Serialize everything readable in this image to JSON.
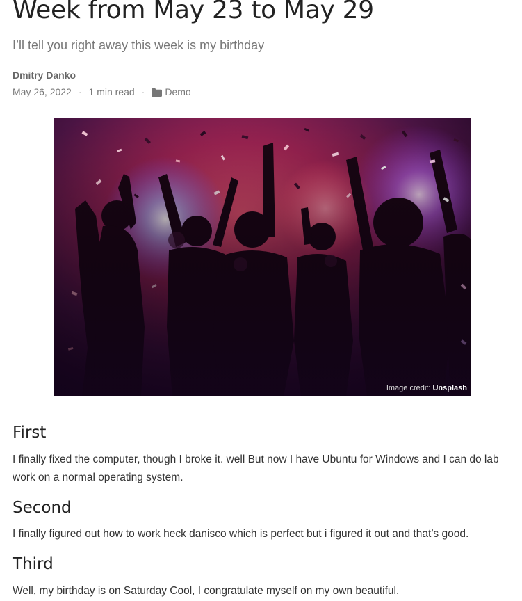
{
  "post": {
    "title": "Week from May 23 to May 29",
    "subtitle": "I’ll tell you right away this week is my birthday",
    "author": "Dmitry Danko",
    "date": "May 26, 2022",
    "read_time": "1 min read",
    "category": "Demo",
    "category_icon": "folder-icon",
    "image": {
      "credit_label": "Image credit:",
      "credit_source": "Unsplash"
    },
    "sections": [
      {
        "heading": "First",
        "body": "I finally fixed the computer, though I broke it. well But now I have Ubuntu for Windows and I can do lab work on a normal operating system."
      },
      {
        "heading": "Second",
        "body": "I finally figured out how to work heck danisco which is perfect but i figured it out and that’s good."
      },
      {
        "heading": "Third",
        "body": "Well, my birthday is on Saturday Cool, I congratulate myself on my own beautiful."
      }
    ]
  }
}
